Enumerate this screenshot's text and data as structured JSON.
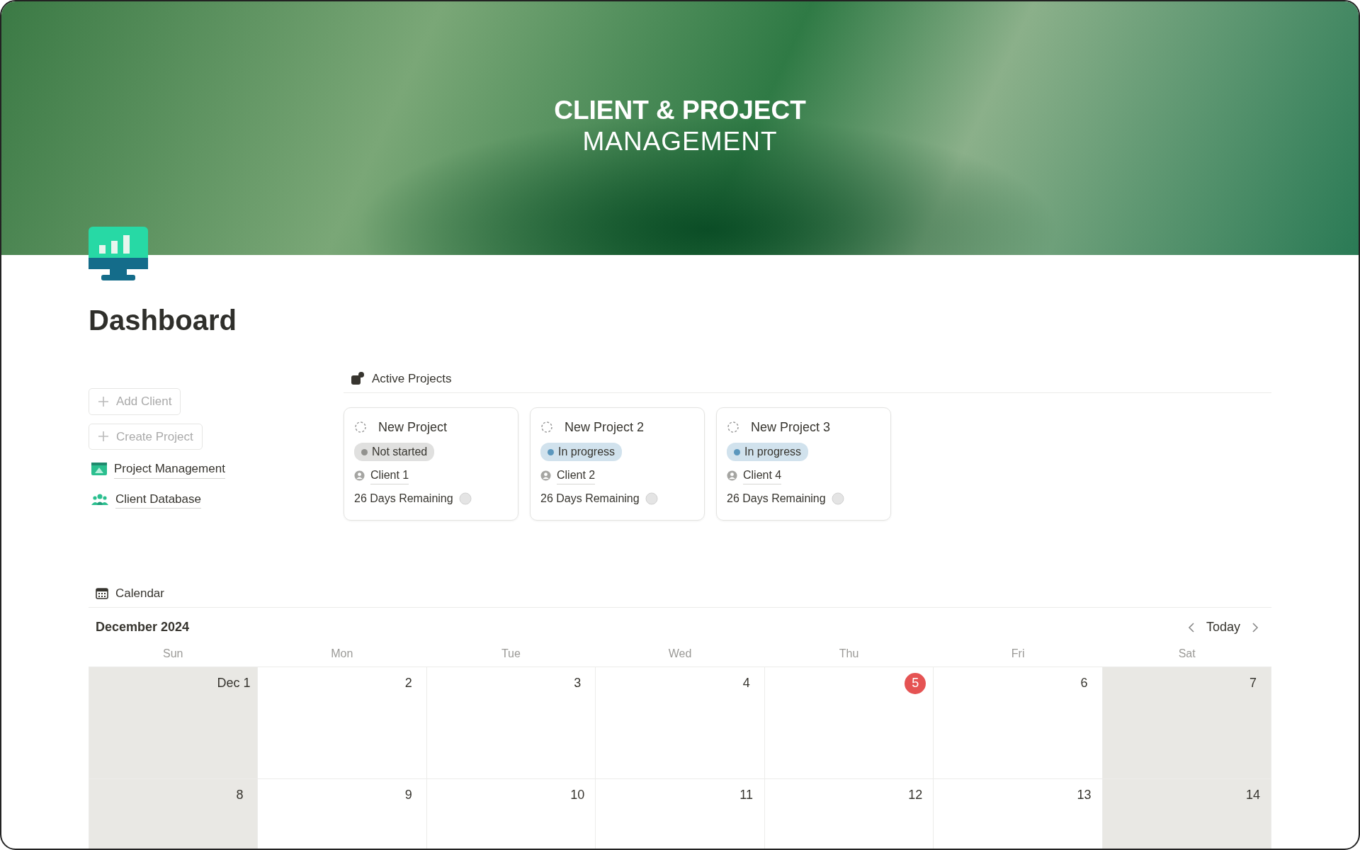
{
  "banner": {
    "title_line_1": "CLIENT & PROJECT",
    "title_line_2": "MANAGEMENT"
  },
  "page": {
    "title": "Dashboard"
  },
  "sidebar": {
    "buttons": [
      {
        "label": "Add Client",
        "kind": "add"
      },
      {
        "label": "Create Project",
        "kind": "add"
      }
    ],
    "links": [
      {
        "label": "Project Management",
        "kind": "board"
      },
      {
        "label": "Client Database",
        "kind": "people"
      }
    ]
  },
  "active_projects": {
    "heading": "Active Projects",
    "cards": [
      {
        "title": "New Project",
        "status": {
          "label": "Not started",
          "color": "#91918e"
        },
        "client": "Client 1",
        "remaining": "26 Days Remaining"
      },
      {
        "title": "New Project 2",
        "status": {
          "label": "In progress",
          "color": "#5b97bd"
        },
        "client": "Client 2",
        "remaining": "26 Days Remaining"
      },
      {
        "title": "New Project 3",
        "status": {
          "label": "In progress",
          "color": "#5b97bd"
        },
        "client": "Client 4",
        "remaining": "26 Days Remaining"
      }
    ]
  },
  "calendar": {
    "heading": "Calendar",
    "month": "December 2024",
    "today_button": "Today",
    "weekdays": [
      "Sun",
      "Mon",
      "Tue",
      "Wed",
      "Thu",
      "Fri",
      "Sat"
    ],
    "weeks": [
      [
        {
          "label": "Dec 1",
          "weekend": true,
          "today": false
        },
        {
          "label": "2",
          "weekend": false,
          "today": false
        },
        {
          "label": "3",
          "weekend": false,
          "today": false
        },
        {
          "label": "4",
          "weekend": false,
          "today": false
        },
        {
          "label": "5",
          "weekend": false,
          "today": true
        },
        {
          "label": "6",
          "weekend": false,
          "today": false
        },
        {
          "label": "7",
          "weekend": true,
          "today": false
        }
      ],
      [
        {
          "label": "8",
          "weekend": true,
          "today": false
        },
        {
          "label": "9",
          "weekend": false,
          "today": false
        },
        {
          "label": "10",
          "weekend": false,
          "today": false
        },
        {
          "label": "11",
          "weekend": false,
          "today": false
        },
        {
          "label": "12",
          "weekend": false,
          "today": false
        },
        {
          "label": "13",
          "weekend": false,
          "today": false
        },
        {
          "label": "14",
          "weekend": true,
          "today": false
        }
      ]
    ]
  }
}
